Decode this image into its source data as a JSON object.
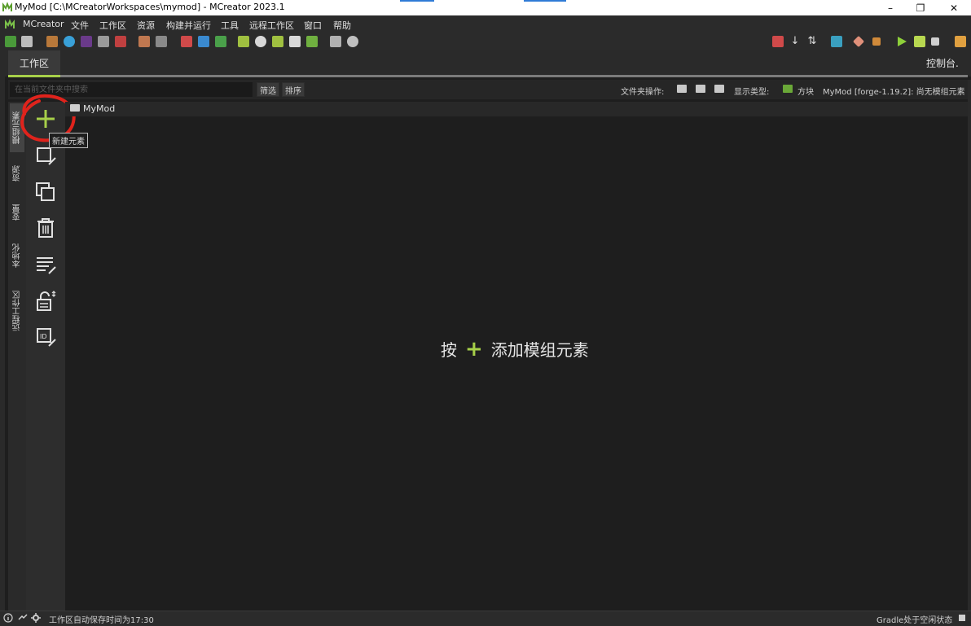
{
  "window": {
    "title": "MyMod [C:\\MCreatorWorkspaces\\mymod] - MCreator 2023.1",
    "controls": [
      "minimize",
      "restore",
      "close"
    ]
  },
  "menu": {
    "items": [
      "MCreator",
      "文件",
      "工作区",
      "资源",
      "构建并运行",
      "工具",
      "远程工作区",
      "窗口",
      "帮助"
    ]
  },
  "tabs": {
    "workspace": "工作区",
    "console": "控制台."
  },
  "filter": {
    "search_placeholder": "在当前文件夹中搜索",
    "filter_button": "筛选",
    "sort_button": "排序",
    "folder_ops_label": "文件夹操作:",
    "display_type_label": "显示类型:",
    "display_type_value": "方块",
    "mod_status": "MyMod [forge-1.19.2]: 尚无模组元素"
  },
  "vertical_tabs": [
    "模组元素",
    "资源",
    "变量",
    "本地化",
    "远程工作区"
  ],
  "actions": {
    "new_element_tooltip": "新建元素",
    "icons": [
      "add-element-icon",
      "edit-element-icon",
      "duplicate-element-icon",
      "delete-element-icon",
      "edit-code-icon",
      "lock-element-icon",
      "edit-registry-name-icon"
    ]
  },
  "tree": {
    "root_folder": "MyMod"
  },
  "empty_hint": {
    "prefix": "按",
    "plus": "+",
    "suffix": "添加模组元素"
  },
  "status": {
    "left": "工作区自动保存时间为17:30",
    "right": "Gradle处于空闲状态"
  },
  "colors": {
    "accent_green": "#a7d049",
    "background": "#1e1e1e",
    "annotation_red": "#e0231c"
  }
}
